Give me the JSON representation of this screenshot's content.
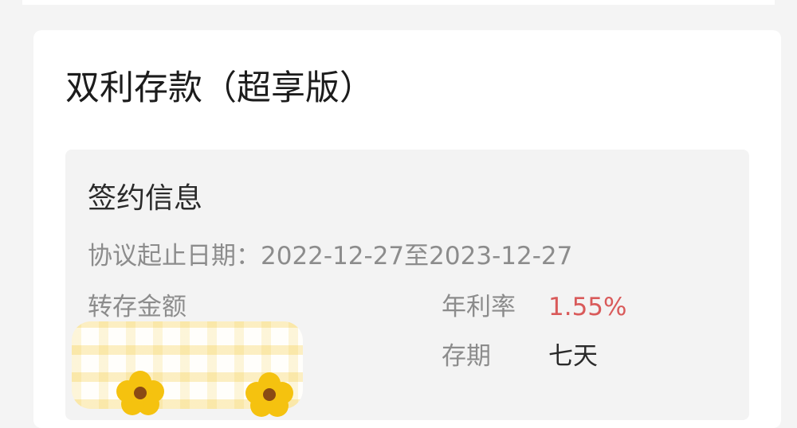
{
  "product": {
    "title": "双利存款（超享版）"
  },
  "contract": {
    "section_title": "签约信息",
    "period_label": "协议起止日期：",
    "start_date": "2022-12-27",
    "date_separator": "至",
    "end_date": "2023-12-27",
    "transfer_amount_label": "转存金额",
    "annual_rate_label": "年利率",
    "annual_rate_value": "1.55%",
    "term_label": "存期",
    "term_value": "七天"
  },
  "colors": {
    "rate_highlight": "#d95a5a",
    "page_background": "#f4f4f4",
    "card_background": "#ffffff",
    "panel_background": "#f3f3f3"
  },
  "icons": {
    "redaction_sticker": "flower-icon"
  }
}
